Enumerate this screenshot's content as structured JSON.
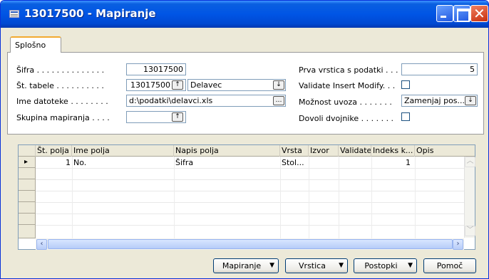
{
  "window": {
    "title": "13017500 - Mapiranje"
  },
  "tabs": [
    {
      "label": "Splošno"
    }
  ],
  "form": {
    "left": [
      {
        "label": "Šifra . . . . . . . . . . . . . .",
        "value": "13017500"
      },
      {
        "label": "Št. tabele . . . . . . . . . .",
        "value": "13017500",
        "value2": "Delavec"
      },
      {
        "label": "Ime datoteke . . . . . . . .",
        "value": "d:\\podatki\\delavci.xls"
      },
      {
        "label": "Skupina mapiranja . . . .",
        "value": ""
      }
    ],
    "right": [
      {
        "label": "Prva vrstica s podatki . . .",
        "value": "5"
      },
      {
        "label": "Validate Insert Modify. . .",
        "checked": false
      },
      {
        "label": "Možnost uvoza . . . . . . .",
        "value": "Zamenjaj pos..."
      },
      {
        "label": "Dovoli dvojnike . . . . . . .",
        "checked": false
      }
    ]
  },
  "grid": {
    "columns": [
      "Št. polja",
      "Ime polja",
      "Napis polja",
      "Vrsta",
      "Izvor",
      "Validate",
      "Indeks k...",
      "Opis"
    ],
    "rows": [
      {
        "st_polja": "1",
        "ime_polja": "No.",
        "napis_polja": "Šifra",
        "vrsta": "Stol...",
        "izvor": "",
        "validate": "",
        "indeks": "1",
        "opis": ""
      }
    ],
    "current_row_marker": "▸"
  },
  "buttons": {
    "mapiranje": "Mapiranje",
    "vrstica": "Vrstica",
    "postopki": "Postopki",
    "pomoc": "Pomoč"
  },
  "icons": {
    "lookup": "↑",
    "dropdown": "↓",
    "assist": "…"
  }
}
